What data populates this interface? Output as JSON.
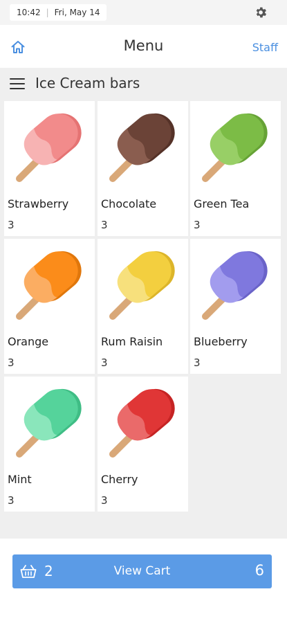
{
  "status_bar": {
    "time": "10:42",
    "date": "Fri, May 14",
    "settings_icon": "gear-icon"
  },
  "header": {
    "title": "Menu",
    "home_icon": "home-icon",
    "staff_label": "Staff"
  },
  "category": {
    "menu_icon": "hamburger-icon",
    "title": "Ice Cream bars"
  },
  "products": [
    {
      "name": "Strawberry",
      "count": "3",
      "color": "#f28b8b",
      "shade": "#e57373",
      "drip": "#f7b3b3"
    },
    {
      "name": "Chocolate",
      "count": "3",
      "color": "#6b4337",
      "shade": "#553228",
      "drip": "#8a5d4f"
    },
    {
      "name": "Green Tea",
      "count": "3",
      "color": "#7cbc46",
      "shade": "#66a236",
      "drip": "#98cf66"
    },
    {
      "name": "Orange",
      "count": "3",
      "color": "#fb8c1a",
      "shade": "#e0770c",
      "drip": "#fbad62"
    },
    {
      "name": "Rum Raisin",
      "count": "3",
      "color": "#f3cf3f",
      "shade": "#dcb52a",
      "drip": "#f7e07c"
    },
    {
      "name": "Blueberry",
      "count": "3",
      "color": "#7f78de",
      "shade": "#6a63c8",
      "drip": "#a29cee"
    },
    {
      "name": "Mint",
      "count": "3",
      "color": "#55d39b",
      "shade": "#3fbd85",
      "drip": "#8ae6bb"
    },
    {
      "name": "Cherry",
      "count": "3",
      "color": "#e03636",
      "shade": "#c52424",
      "drip": "#ea6a6a"
    }
  ],
  "cart": {
    "icon": "basket-icon",
    "quantity": "2",
    "label": "View Cart",
    "total": "6",
    "color": "#5b9be6"
  }
}
